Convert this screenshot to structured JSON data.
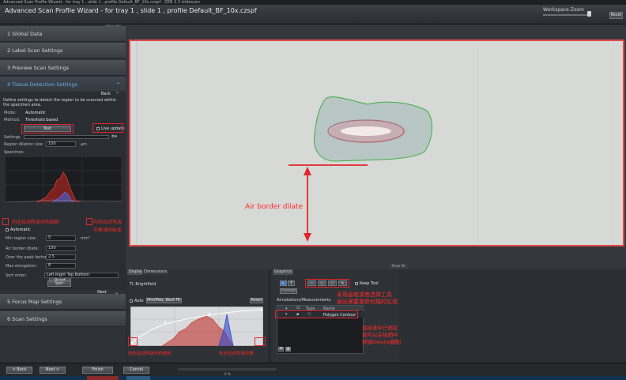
{
  "window": {
    "titlebar": "Advanced Scan Profile Wizard -   for tray 1 , slide 1 , profile Default_BF_10x.czspf  -  ZEN 2.3 slidescan",
    "title": "Advanced Scan Profile Wizard -   for tray 1 , slide 1 , profile Default_BF_10x.czspf"
  },
  "workspace_zoom": {
    "label": "Workspace Zoom",
    "reset": "Reset"
  },
  "show_all": "Show All",
  "sections": [
    {
      "label": "1  Global Data"
    },
    {
      "label": "2  Label Scan Settings"
    },
    {
      "label": "3  Preview Scan Settings"
    },
    {
      "label": "4  Tissue Detection Settings"
    },
    {
      "label": "5  Focus Map Settings"
    },
    {
      "label": "6  Scan Settings"
    }
  ],
  "tissue": {
    "back": "Back",
    "description": "Define settings to detect the region to be scanned within the specimen area.",
    "mode_label": "Mode:",
    "mode_value": "Automatic",
    "method_label": "Method:",
    "method_value": "Threshold based",
    "test": "Test",
    "live_update": "Live update",
    "settings_label": "Settings",
    "region_dilation_label": "Region dilation size:",
    "region_dilation_value": "150",
    "region_dilation_unit": "µm",
    "specimen_label": "Specimen",
    "automatic": "Automatic",
    "min_region_label": "Min region size:",
    "min_region_value": "5",
    "min_region_unit": "mm²",
    "air_border_label": "Air border dilate:",
    "air_border_value": "150",
    "over_peak_label": "Over the peak factor:",
    "over_peak_value": "2.5",
    "max_elong_label": "Max elongation:",
    "max_elong_value": "8",
    "reset": "Reset",
    "sort_order_label": "Sort order:",
    "sort_order_value": "Left Right Top Bottom",
    "sort": "Sort",
    "next": "Next"
  },
  "annotations": {
    "left_hist_left": "向左拉动所选中的组织",
    "left_hist_right_1": "向右拉动可选",
    "left_hist_right_2": "中更浅的标本",
    "air_border_dilate": "Air border dilate",
    "graphics_1": "采用画笔或者选择工具",
    "graphics_2": "画出需要重新扫描的区域",
    "poly_1": "直接选中已画区",
    "poly_2": "域可以在绘图中",
    "poly_3": "按键Delete键删除",
    "disp_left": "向右拉动所选中的组织",
    "disp_right": "向左拉动可选中更"
  },
  "display": {
    "tabs": [
      "Display",
      "Dimensions"
    ],
    "channel": "TL Brightfield",
    "auto": "Auto",
    "minmax": "Min/Max",
    "bestfit": "Best Fit",
    "reset": "Reset"
  },
  "graphics": {
    "tab": "Graphics",
    "keep_tool": "Keep Tool",
    "format": "Format",
    "ann_header": "Annotations/Measurements",
    "col_type": "Type",
    "col_name": "Name",
    "row_name": "Polygon Contour"
  },
  "footer": {
    "back": "< Back",
    "next": "Next >",
    "finish": "Finish",
    "cancel": "Cancel",
    "percent": "0 %"
  },
  "colors": {
    "highlight_red": "#e2262c",
    "tissue_green": "#3fae45",
    "accent_blue": "#6fb0e8"
  }
}
